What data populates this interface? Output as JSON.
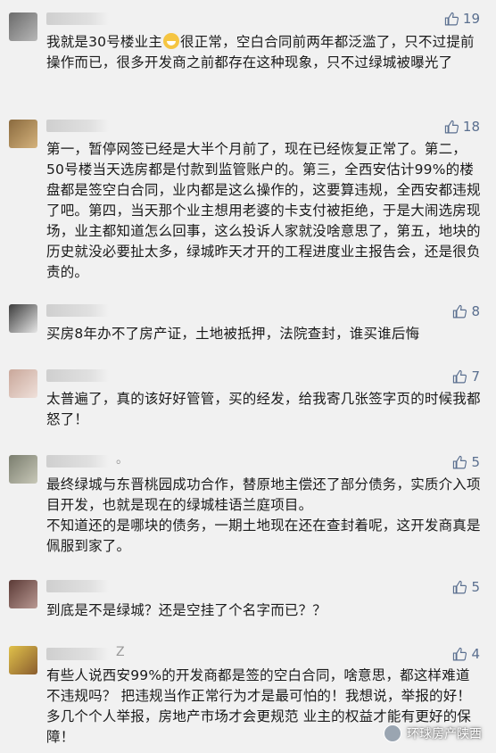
{
  "comments": [
    {
      "username_suffix": "",
      "likes": "19",
      "text_before_emoji": "我就是30号楼业主",
      "emoji": "grin-emoji",
      "text_after_emoji": "很正常，空白合同前两年都泛滥了，只不过提前操作而已，很多开发商之前都存在这种现象，只不过绿城被曝光了"
    },
    {
      "username_suffix": "",
      "likes": "18",
      "text": "第一，暂停网签已经是大半个月前了，现在已经恢复正常了。第二，50号楼当天选房都是付款到监管账户的。第三，全西安估计99%的楼盘都是签空白合同，业内都是这么操作的，这要算违规，全西安都违规了吧。第四，当天那个业主想用老婆的卡支付被拒绝，于是大闹选房现场，业主都知道怎么回事，这么投诉人家就没啥意思了，第五，地块的历史就没必要扯太多，绿城昨天才开的工程进度业主报告会，还是很负责的。"
    },
    {
      "username_suffix": "",
      "likes": "8",
      "text": "买房8年办不了房产证，土地被抵押，法院查封，谁买谁后悔"
    },
    {
      "username_suffix": "",
      "likes": "7",
      "text": "太普遍了，真的该好好管管，买的经发，给我寄几张签字页的时候我都怒了！"
    },
    {
      "username_suffix": "。",
      "likes": "5",
      "text": "最终绿城与东晋桃园成功合作，替原地主偿还了部分债务，实质介入项目开发，也就是现在的绿城桂语兰庭项目。\n不知道还的是哪块的债务，一期土地现在还在查封着呢，这开发商真是佩服到家了。"
    },
    {
      "username_suffix": "",
      "likes": "5",
      "text": "到底是不是绿城？还是空挂了个名字而已？？"
    },
    {
      "username_suffix": "Z",
      "likes": "4",
      "text": "有些人说西安99%的开发商都是签的空白合同，啥意思，都这样难道不违规吗？ 把违规当作正常行为才是最可怕的！我想说，举报的好！多几个个人举报，房地产市场才会更规范 业主的权益才能有更好的保障！"
    }
  ],
  "watermark": "环球房产陕西",
  "colors": {
    "background": "#f1f1f1",
    "like": "#5a6f8f",
    "text": "#1a1a1a"
  }
}
